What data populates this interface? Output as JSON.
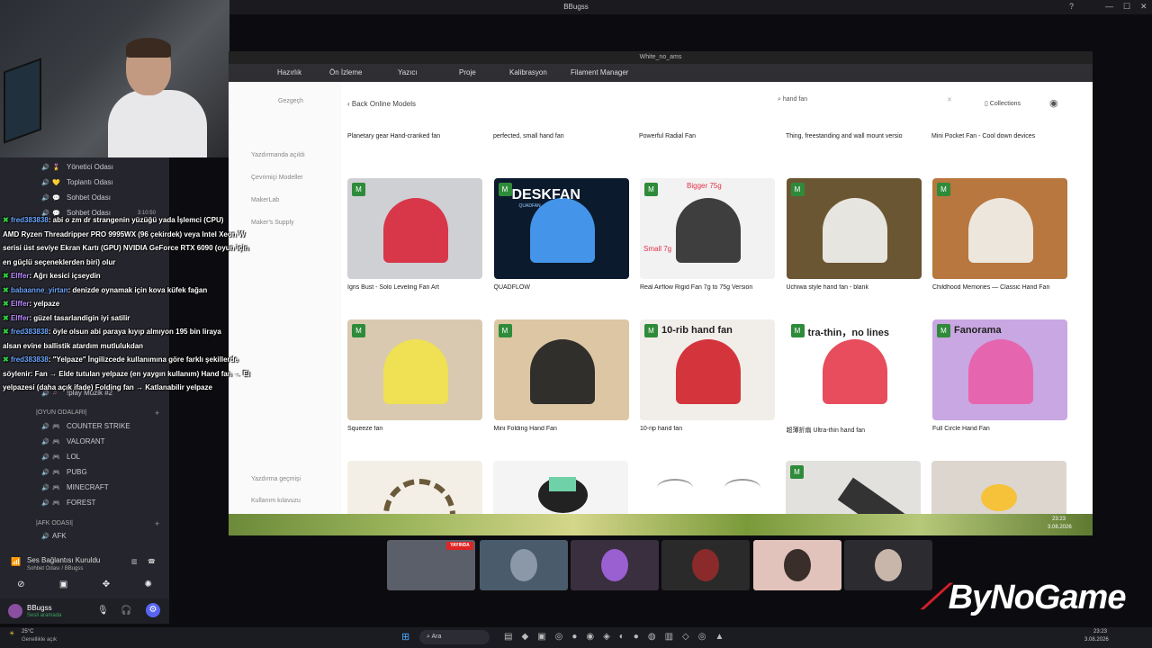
{
  "window": {
    "title": "BBugss"
  },
  "discord": {
    "channels": [
      {
        "label": "Yönetici Odası",
        "emoji": "🎖️"
      },
      {
        "label": "Toplantı Odası",
        "emoji": "💛"
      },
      {
        "label": "Sohbet Odası",
        "emoji": "💬"
      },
      {
        "label": "Sohbet Odası",
        "emoji": "💬",
        "timer": "3:10:50"
      }
    ],
    "channels2": [
      {
        "label": "!play Müzik #2"
      }
    ],
    "games_category": "|OYUN ODALARI|",
    "games": [
      "COUNTER STRIKE",
      "VALORANT",
      "LOL",
      "PUBG",
      "MINECRAFT",
      "FOREST"
    ],
    "afk_category": "|AFK ODASI|",
    "afk": "AFK",
    "voice_status": "Ses Bağlantısı Kuruldu",
    "voice_sub": "Sohbet Odası / BBugss",
    "user_name": "BBugss",
    "user_status": "Sesli aramada"
  },
  "chat": [
    {
      "user": "fred383838",
      "text": ": abi o zm dr strangenin yüzüğü yada İşlemci (CPU)"
    },
    {
      "user": "",
      "text": "AMD Ryzen Threadripper PRO 9995WX (96 çekirdek) veya Intel Xeon W"
    },
    {
      "user": "",
      "text": "serisi üst seviye Ekran Kartı (GPU) NVIDIA GeForce RTX 6090 (oyun için"
    },
    {
      "user": "",
      "text": "en güçlü seçeneklerden biri) olur"
    },
    {
      "user": "Elffer",
      "text": ": Ağrı kesici içseydin"
    },
    {
      "user": "babaanne_yirtan",
      "text": ": denizde oynamak için kova küfek fağan"
    },
    {
      "user": "Elffer",
      "text": ": yelpaze"
    },
    {
      "user": "Elffer",
      "text": ": güzel tasarlandigin iyi satilir"
    },
    {
      "user": "fred383838",
      "text": ": öyle olsun abi paraya kıyıp almıyon 195 bin liraya"
    },
    {
      "user": "",
      "text": "alsan evine ballistik atardım mutlulukdan"
    },
    {
      "user": "fred383838",
      "text": ": \"Yelpaze\" İngilizcede kullanımına göre farklı şekillerde"
    },
    {
      "user": "",
      "text": "söylenir: Fan → Elde tutulan yelpaze (en yaygın kullanım) Hand fan → El"
    },
    {
      "user": "",
      "text": "yelpazesi (daha açık ifade) Folding fan → Katlanabilir yelpaze"
    }
  ],
  "slicer": {
    "title": "White_no_ams",
    "toolbar": [
      "Hazırlık",
      "Ön İzleme",
      "Yazıcı",
      "Proje",
      "Kalibrasyon",
      "Filament Manager"
    ],
    "side": [
      "Gezgeçh",
      "Yazdırmanda açıldı",
      "Çevrimiçi Modeller",
      "MakerLab",
      "Maker's Supply",
      "Yazdırma geçmişi",
      "Kullanım kılavuzu"
    ],
    "back": "Back Online Models",
    "search": "hand fan",
    "collections": "Collections",
    "top_row": [
      "Planetary gear Hand-cranked fan",
      "perfected, small hand fan",
      "Powerful Radial Fan",
      "Thing, freestanding and wall mount versio",
      "Mini Pocket Fan - Cool down devices"
    ],
    "row1": [
      {
        "name": "Igris Bust - Solo Leveling Fan Art",
        "bg": "#cfd0d3",
        "accent": "#d8263a"
      },
      {
        "name": "QUADFLOW",
        "bg": "#0b1a2c",
        "accent": "#4aa3ff"
      },
      {
        "name": "Real Airflow Rigid Fan 7g to 75g Version",
        "bg": "#f2f2f2",
        "accent": "#2a2a2a"
      },
      {
        "name": "Uchiwa style hand fan - blank",
        "bg": "#6b5633",
        "accent": "#f5f5f2"
      },
      {
        "name": "Childhood Memories — Classic Hand Fan",
        "bg": "#b7773e",
        "accent": "#f2f2ee"
      }
    ],
    "row2": [
      {
        "name": "Squeeze fan",
        "bg": "#d9c9b0",
        "accent": "#f1e24a"
      },
      {
        "name": "Mini Folding Hand Fan",
        "bg": "#dcc6a4",
        "accent": "#1e1e1e"
      },
      {
        "name": "10-rip hand fan",
        "bg": "#f1eeea",
        "accent": "#d0202a",
        "label": "10-rib hand fan"
      },
      {
        "name": "超薄折扇 Ultra-thin hand fan",
        "bg": "#ffffff",
        "accent": "#e43a4a",
        "label": "tra-thin，no lines"
      },
      {
        "name": "Full Circle Hand Fan",
        "bg": "#c9a7e2",
        "accent": "#e85fa8",
        "label": "Fanorama"
      }
    ],
    "qf_title": "DESKFAN",
    "qf_sub": "QUADFAN",
    "bigger": "Bigger 75g",
    "small": "Small 7g",
    "time": "23:23",
    "date": "3.08.2026"
  },
  "call": {
    "live_label": "YAYINDA"
  },
  "brand": "ByNoGame",
  "taskbar": {
    "search": "Ara",
    "weather": "25°C",
    "weather_sub": "Genellikle açık",
    "time": "23:23",
    "date": "3.08.2026"
  }
}
